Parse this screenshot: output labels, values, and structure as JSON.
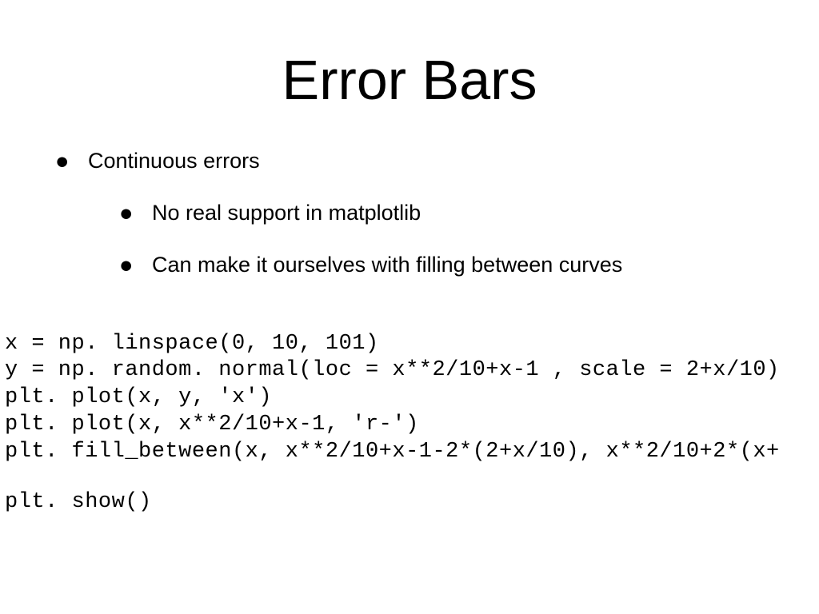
{
  "title": "Error Bars",
  "bullets": {
    "main": "Continuous errors",
    "sub1": "No real support in matplotlib",
    "sub2": "Can make it ourselves with filling between curves"
  },
  "code": {
    "line1": "x = np. linspace(0, 10, 101)",
    "line2": "y = np. random. normal(loc = x**2/10+x-1 , scale = 2+x/10)",
    "line3": "plt. plot(x, y, 'x')",
    "line4": "plt. plot(x, x**2/10+x-1, 'r-')",
    "line5": "plt. fill_between(x, x**2/10+x-1-2*(2+x/10), x**2/10+2*(x+",
    "line6": "plt. show()"
  }
}
